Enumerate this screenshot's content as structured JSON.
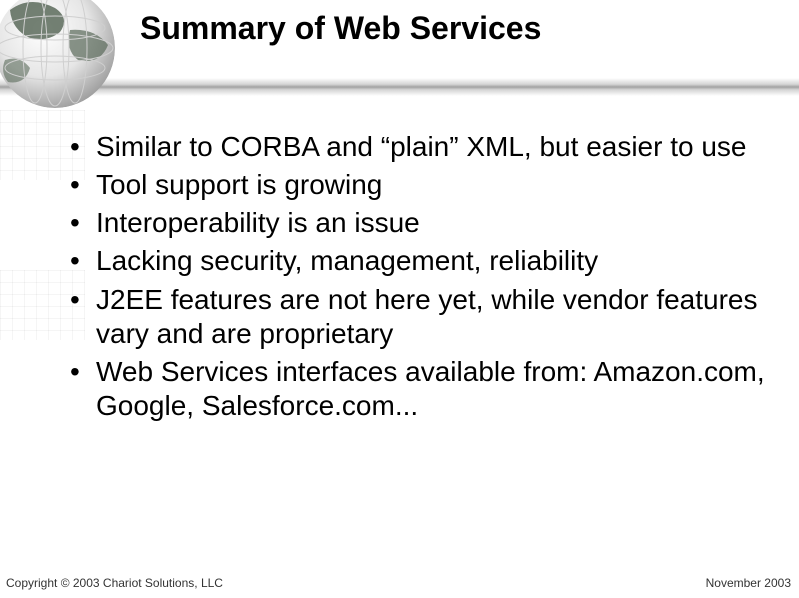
{
  "title": "Summary of Web Services",
  "bullets": [
    "Similar to CORBA and “plain” XML, but easier to use",
    "Tool support is growing",
    "Interoperability is an issue",
    "Lacking security, management, reliability",
    "J2EE features are not here yet, while vendor features vary and are proprietary",
    "Web Services interfaces available from: Amazon.com, Google, Salesforce.com..."
  ],
  "footer_left": "Copyright © 2003 Chariot Solutions, LLC",
  "footer_right": "November 2003"
}
